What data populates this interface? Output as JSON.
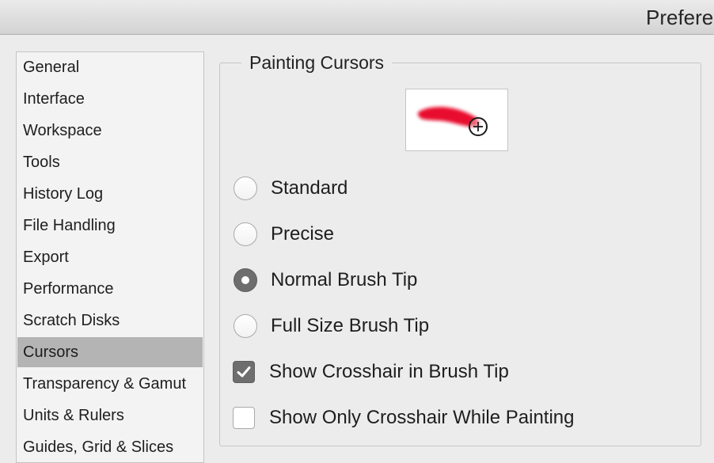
{
  "window": {
    "title": "Prefere"
  },
  "sidebar": {
    "items": [
      {
        "label": "General"
      },
      {
        "label": "Interface"
      },
      {
        "label": "Workspace"
      },
      {
        "label": "Tools"
      },
      {
        "label": "History Log"
      },
      {
        "label": "File Handling"
      },
      {
        "label": "Export"
      },
      {
        "label": "Performance"
      },
      {
        "label": "Scratch Disks"
      },
      {
        "label": "Cursors",
        "selected": true
      },
      {
        "label": "Transparency & Gamut"
      },
      {
        "label": "Units & Rulers"
      },
      {
        "label": "Guides, Grid & Slices"
      }
    ]
  },
  "painting_cursors": {
    "title": "Painting Cursors",
    "preview_icon": "brush-stroke-crosshair-preview",
    "brush_color": "#e8112d",
    "radio_options": [
      {
        "label": "Standard",
        "checked": false
      },
      {
        "label": "Precise",
        "checked": false
      },
      {
        "label": "Normal Brush Tip",
        "checked": true
      },
      {
        "label": "Full Size Brush Tip",
        "checked": false
      }
    ],
    "checkboxes": [
      {
        "label": "Show Crosshair in Brush Tip",
        "checked": true
      },
      {
        "label": "Show Only Crosshair While Painting",
        "checked": false
      }
    ]
  },
  "colors": {
    "selected_item_bg": "#b4b4b4",
    "control_checked": "#6e6e6e"
  }
}
